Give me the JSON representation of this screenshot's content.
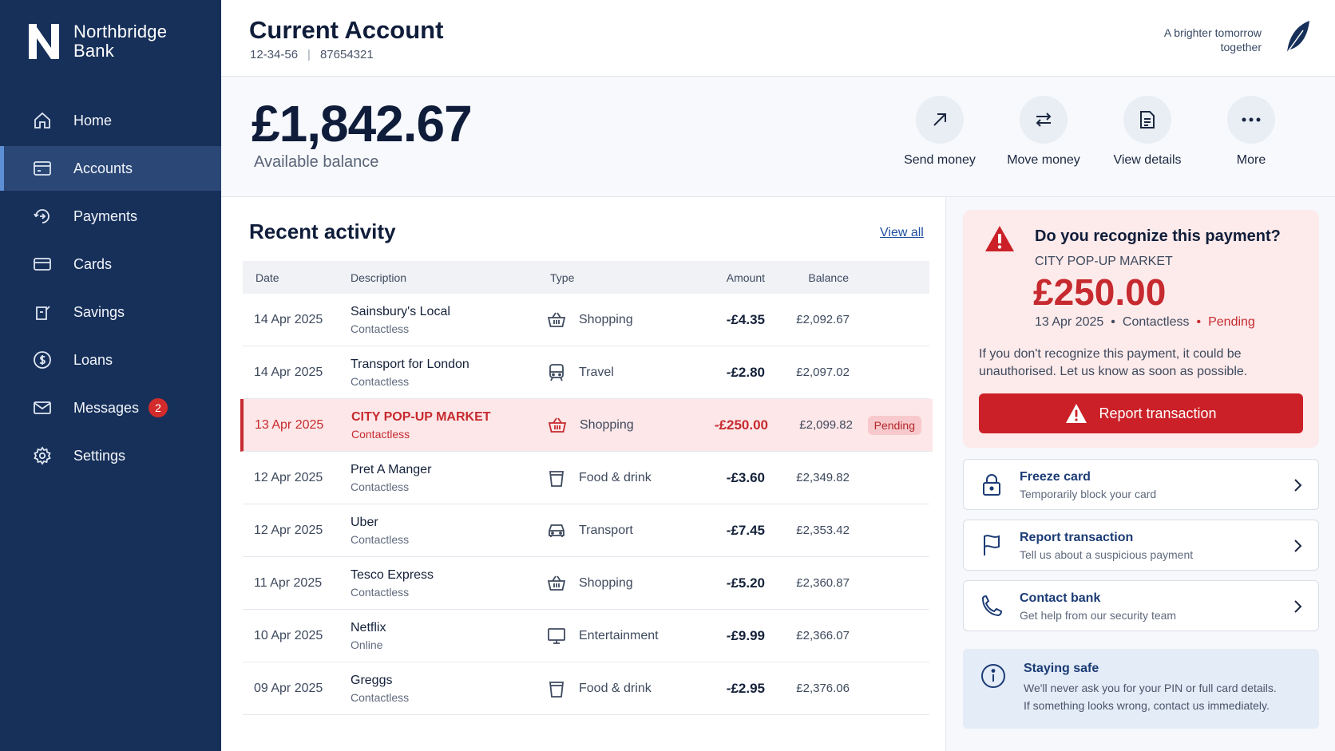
{
  "brand": {
    "name_line1": "Northbridge",
    "name_line2": "Bank",
    "tagline_line1": "A brighter tomorrow",
    "tagline_line2": "together"
  },
  "sidebar": {
    "items": [
      {
        "label": "Home",
        "icon": "home-icon"
      },
      {
        "label": "Accounts",
        "icon": "accounts-icon",
        "active": true
      },
      {
        "label": "Payments",
        "icon": "payments-icon"
      },
      {
        "label": "Cards",
        "icon": "card-icon"
      },
      {
        "label": "Savings",
        "icon": "savings-icon"
      },
      {
        "label": "Loans",
        "icon": "loans-icon"
      },
      {
        "label": "Messages",
        "icon": "mail-icon",
        "badge": "2"
      },
      {
        "label": "Settings",
        "icon": "gear-icon"
      }
    ]
  },
  "account": {
    "title": "Current Account",
    "sort_code": "12-34-56",
    "separator": "|",
    "number": "87654321",
    "balance": "£1,842.67",
    "balance_label": "Available balance"
  },
  "actions": [
    {
      "label": "Send money",
      "icon": "arrow-up-right-icon"
    },
    {
      "label": "Move money",
      "icon": "swap-arrows-icon"
    },
    {
      "label": "View details",
      "icon": "document-icon"
    },
    {
      "label": "More",
      "icon": "more-dots-icon"
    }
  ],
  "activity": {
    "title": "Recent activity",
    "view_all": "View all",
    "columns": {
      "date": "Date",
      "description": "Description",
      "type": "Type",
      "amount": "Amount",
      "balance": "Balance"
    },
    "rows": [
      {
        "date": "14 Apr 2025",
        "desc": "Sainsbury's Local",
        "method": "Contactless",
        "type": "Shopping",
        "icon": "basket-icon",
        "amount": "-£4.35",
        "balance": "£2,092.67"
      },
      {
        "date": "14 Apr 2025",
        "desc": "Transport for London",
        "method": "Contactless",
        "type": "Travel",
        "icon": "train-icon",
        "amount": "-£2.80",
        "balance": "£2,097.02"
      },
      {
        "date": "13 Apr 2025",
        "desc": "CITY POP-UP MARKET",
        "method": "Contactless",
        "type": "Shopping",
        "icon": "basket-icon",
        "amount": "-£250.00",
        "balance": "£2,099.82",
        "status": "Pending"
      },
      {
        "date": "12 Apr 2025",
        "desc": "Pret A Manger",
        "method": "Contactless",
        "type": "Food & drink",
        "icon": "cup-icon",
        "amount": "-£3.60",
        "balance": "£2,349.82"
      },
      {
        "date": "12 Apr 2025",
        "desc": "Uber",
        "method": "Contactless",
        "type": "Transport",
        "icon": "car-icon",
        "amount": "-£7.45",
        "balance": "£2,353.42"
      },
      {
        "date": "11 Apr 2025",
        "desc": "Tesco Express",
        "method": "Contactless",
        "type": "Shopping",
        "icon": "basket-icon",
        "amount": "-£5.20",
        "balance": "£2,360.87"
      },
      {
        "date": "10 Apr 2025",
        "desc": "Netflix",
        "method": "Online",
        "type": "Entertainment",
        "icon": "monitor-icon",
        "amount": "-£9.99",
        "balance": "£2,366.07"
      },
      {
        "date": "09 Apr 2025",
        "desc": "Greggs",
        "method": "Contactless",
        "type": "Food & drink",
        "icon": "cup-icon",
        "amount": "-£2.95",
        "balance": "£2,376.06"
      }
    ]
  },
  "alert": {
    "title": "Do you recognize this payment?",
    "merchant": "CITY POP-UP MARKET",
    "amount": "£250.00",
    "date": "13 Apr 2025",
    "dot": "•",
    "method": "Contactless",
    "status": "Pending",
    "message": "If you don't recognize this payment, it could be unauthorised. Let us know as soon as possible.",
    "button": "Report transaction"
  },
  "options": [
    {
      "title": "Freeze card",
      "subtitle": "Temporarily block your card",
      "icon": "lock-icon"
    },
    {
      "title": "Report transaction",
      "subtitle": "Tell us about a suspicious payment",
      "icon": "flag-icon"
    },
    {
      "title": "Contact bank",
      "subtitle": "Get help from our security team",
      "icon": "phone-icon"
    }
  ],
  "safety": {
    "title": "Staying safe",
    "line1": "We'll never ask you for your PIN or full card details.",
    "line2": "If something looks wrong, contact us immediately."
  },
  "colors": {
    "sidebar": "#17305a",
    "accent": "#1d4e9e",
    "danger": "#c62a2f",
    "alert_bg": "#fdeaea"
  }
}
